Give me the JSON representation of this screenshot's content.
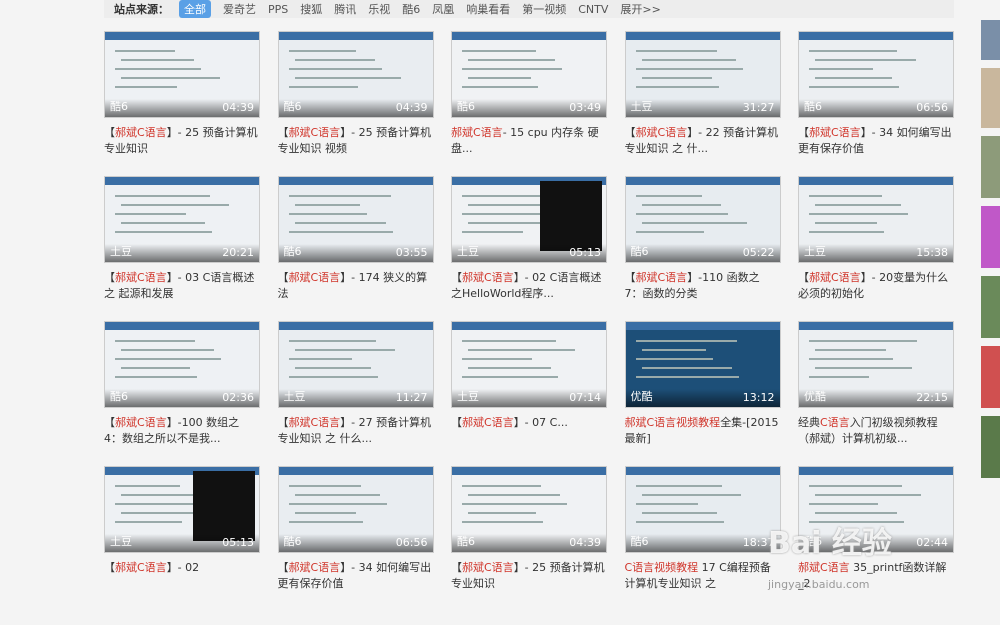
{
  "filter": {
    "label": "站点来源：",
    "items": [
      "全部",
      "爱奇艺",
      "PPS",
      "搜狐",
      "腾讯",
      "乐视",
      "酷6",
      "凤凰",
      "响巢看看",
      "第一视频",
      "CNTV",
      "展开>>"
    ]
  },
  "videos": [
    {
      "source": "酷6",
      "duration": "04:39",
      "pre": "【",
      "hl": "郝斌C语言",
      "post": "】- 25 预备计算机专业知识"
    },
    {
      "source": "酷6",
      "duration": "04:39",
      "pre": "【",
      "hl": "郝斌C语言",
      "post": "】- 25 预备计算机专业知识 视频"
    },
    {
      "source": "酷6",
      "duration": "03:49",
      "pre": "",
      "hl": "郝斌C语言",
      "post": "- 15 cpu 内存条 硬盘..."
    },
    {
      "source": "土豆",
      "duration": "31:27",
      "pre": "【",
      "hl": "郝斌C语言",
      "post": "】- 22 预备计算机专业知识 之 什..."
    },
    {
      "source": "酷6",
      "duration": "06:56",
      "pre": "【",
      "hl": "郝斌C语言",
      "post": "】- 34 如何编写出更有保存价值"
    },
    {
      "source": "土豆",
      "duration": "20:21",
      "pre": "【",
      "hl": "郝斌C语言",
      "post": "】- 03 C语言概述之 起源和发展"
    },
    {
      "source": "酷6",
      "duration": "03:55",
      "pre": "【",
      "hl": "郝斌C语言",
      "post": "】- 174 狭义的算法"
    },
    {
      "source": "土豆",
      "duration": "05:13",
      "pre": "【",
      "hl": "郝斌C语言",
      "post": "】- 02 C语言概述之HelloWorld程序..."
    },
    {
      "source": "酷6",
      "duration": "05:22",
      "pre": "【",
      "hl": "郝斌C语言",
      "post": "】-110 函数之 7：函数的分类"
    },
    {
      "source": "土豆",
      "duration": "15:38",
      "pre": "【",
      "hl": "郝斌C语言",
      "post": "】- 20变量为什么必须的初始化"
    },
    {
      "source": "酷6",
      "duration": "02:36",
      "pre": "【",
      "hl": "郝斌C语言",
      "post": "】-100 数组之 4：数组之所以不是我..."
    },
    {
      "source": "土豆",
      "duration": "11:27",
      "pre": "【",
      "hl": "郝斌C语言",
      "post": "】- 27 预备计算机专业知识 之 什么..."
    },
    {
      "source": "土豆",
      "duration": "07:14",
      "pre": "【",
      "hl": "郝斌C语言",
      "post": "】- 07 C..."
    },
    {
      "source": "优酷",
      "duration": "13:12",
      "pre": "",
      "hl": "郝斌C语言视频教程",
      "post": "全集-[2015最新]"
    },
    {
      "source": "优酷",
      "duration": "22:15",
      "pre": "经典",
      "hl": "C语言",
      "post": "入门初级视频教程（郝斌）计算机初级..."
    },
    {
      "source": "土豆",
      "duration": "05:13",
      "pre": "【",
      "hl": "郝斌C语言",
      "post": "】- 02"
    },
    {
      "source": "酷6",
      "duration": "06:56",
      "pre": "【",
      "hl": "郝斌C语言",
      "post": "】- 34 如何编写出更有保存价值"
    },
    {
      "source": "酷6",
      "duration": "04:39",
      "pre": "【",
      "hl": "郝斌C语言",
      "post": "】- 25 预备计算机专业知识"
    },
    {
      "source": "酷6",
      "duration": "18:37",
      "pre": "",
      "hl": "C语言视频教程",
      "post": " 17 C编程预备计算机专业知识 之"
    },
    {
      "source": "酷6",
      "duration": "02:44",
      "pre": "",
      "hl": "郝斌C语言",
      "post": " 35_printf函数详解_2"
    }
  ],
  "watermark": {
    "text": "Bai 经验",
    "url": "jingyan.baidu.com"
  }
}
